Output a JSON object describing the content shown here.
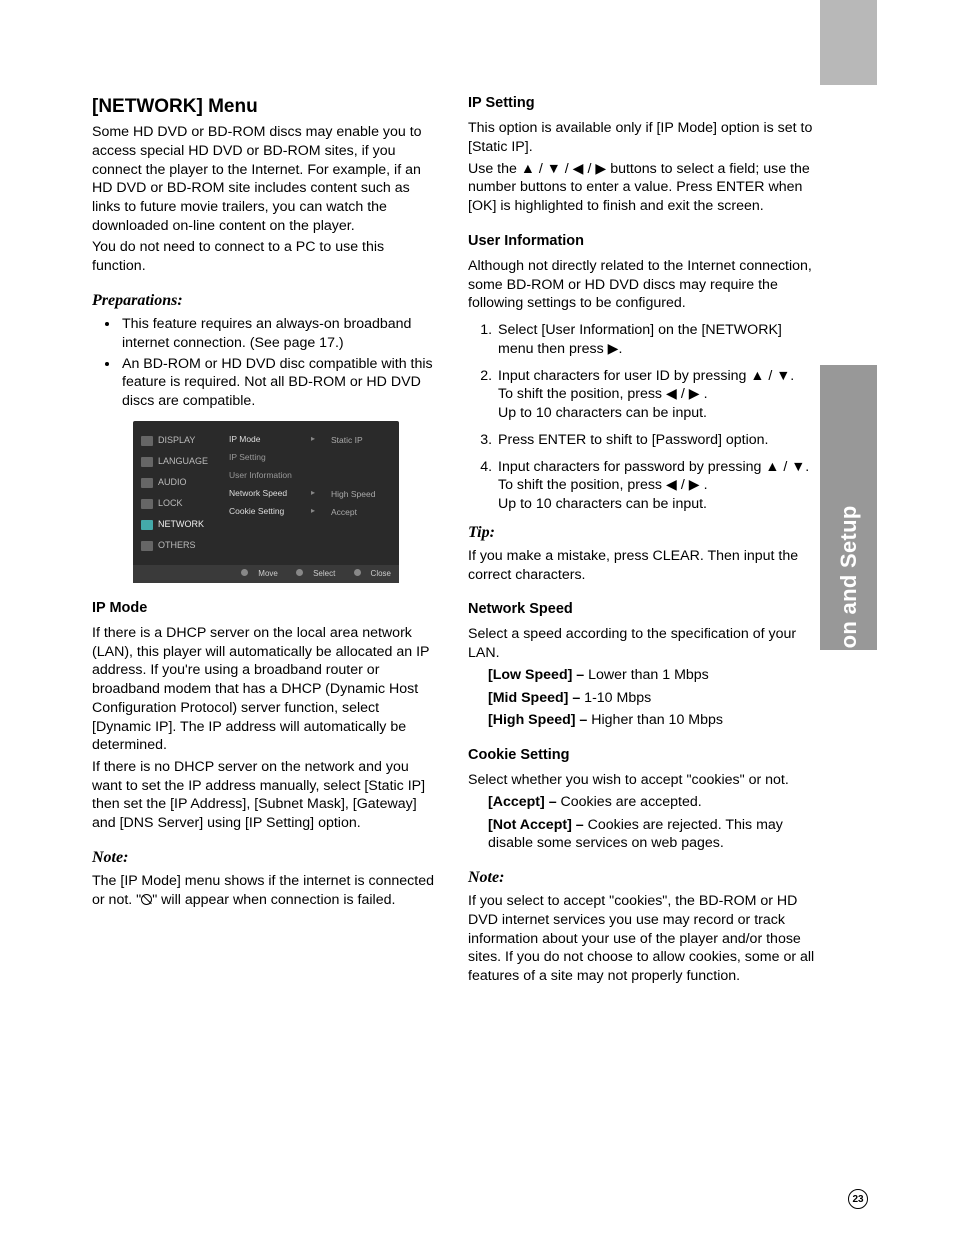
{
  "sideTab": "Installation and Setup",
  "pageNumber": "23",
  "left": {
    "title": "[NETWORK] Menu",
    "intro1": "Some HD DVD or BD-ROM discs may enable you to access special HD DVD or BD-ROM sites, if you connect the player to the Internet. For example, if an HD DVD or BD-ROM site includes content such as links to future movie trailers, you can watch the downloaded on-line content on the player.",
    "intro2": "You do not need to connect to a PC to use this function.",
    "prepHead": "Preparations:",
    "prepBullets": [
      "This feature requires an always-on broadband internet connection. (See page 17.)",
      "An BD-ROM or HD DVD disc compatible with this feature is required. Not all BD-ROM or HD DVD discs are compatible."
    ],
    "screenshot": {
      "side": [
        "DISPLAY",
        "LANGUAGE",
        "AUDIO",
        "LOCK",
        "NETWORK",
        "OTHERS"
      ],
      "mid": [
        {
          "label": "IP Mode",
          "hi": true
        },
        {
          "label": "IP Setting"
        },
        {
          "label": "User Information"
        },
        {
          "label": "Network Speed",
          "hi": true
        },
        {
          "label": "Cookie Setting",
          "hi": true
        }
      ],
      "right": [
        "Static IP",
        "",
        "",
        "High Speed",
        "Accept"
      ],
      "footer": {
        "move": "Move",
        "select": "Select",
        "close": "Close"
      }
    },
    "ipModeHead": "IP Mode",
    "ipMode1": "If there is a DHCP server on the local area network (LAN), this player will automatically be allocated an IP address. If you're using a broadband router or broadband modem that has a DHCP (Dynamic Host Configuration Protocol) server function, select [Dynamic IP]. The IP address will automatically be determined.",
    "ipMode2": "If there is no DHCP server on the network and you want to set the IP address manually, select [Static IP] then set the [IP Address], [Subnet Mask], [Gateway] and [DNS Server] using [IP Setting] option.",
    "noteHead": "Note:",
    "noteText_a": "The [IP Mode] menu shows if the internet is connected or not. \"",
    "noteText_b": "\" will appear when connection is failed."
  },
  "right": {
    "ipSettingHead": "IP Setting",
    "ipSetting1": "This option is available only if [IP Mode] option is set to [Static IP].",
    "ipSetting2_a": "Use the ",
    "ipSetting2_b": " buttons to select a field; use the number buttons to enter a value. Press ENTER when [OK] is highlighted to finish and exit the screen.",
    "userInfoHead": "User Information",
    "userInfo1": "Although not directly related to the Internet connection, some BD-ROM or HD DVD discs may require the following settings to be configured.",
    "steps": {
      "s1_a": "Select [User Information] on the [NETWORK] menu then press ",
      "s1_b": ".",
      "s2_a": "Input characters for user ID by pressing ",
      "s2_b": ".",
      "s2_c": "To shift the position, press ",
      "s2_d": " .",
      "s2_e": "Up to 10 characters can be input.",
      "s3": "Press ENTER to shift to [Password] option.",
      "s4_a": "Input characters for password by pressing ",
      "s4_b": ".",
      "s4_c": "To shift the position, press ",
      "s4_d": " .",
      "s4_e": "Up to 10 characters can be input."
    },
    "tipHead": "Tip:",
    "tipText": "If you make a mistake, press CLEAR. Then input the correct characters.",
    "nsHead": "Network Speed",
    "nsIntro": "Select a speed according to the specification of your LAN.",
    "nsItems": [
      {
        "label": "[Low Speed] –",
        "text": " Lower than 1 Mbps"
      },
      {
        "label": "[Mid Speed] –",
        "text": " 1-10 Mbps"
      },
      {
        "label": "[High Speed] –",
        "text": " Higher than 10 Mbps"
      }
    ],
    "csHead": "Cookie Setting",
    "csIntro": "Select whether you wish to accept \"cookies\" or not.",
    "csItems": [
      {
        "label": "[Accept] –",
        "text": " Cookies are accepted."
      },
      {
        "label": "[Not Accept] –",
        "text": " Cookies are rejected. This may disable some services on web pages."
      }
    ],
    "note2Head": "Note:",
    "note2Text": "If you select to accept \"cookies\", the BD-ROM or HD DVD internet services you use may record or track information about your use of the player and/or those sites. If you do not choose to allow cookies, some or all features of a site may not properly function."
  },
  "glyph": {
    "up": "▲",
    "down": "▼",
    "left": "◀",
    "right": "▶",
    "sep": " / "
  }
}
